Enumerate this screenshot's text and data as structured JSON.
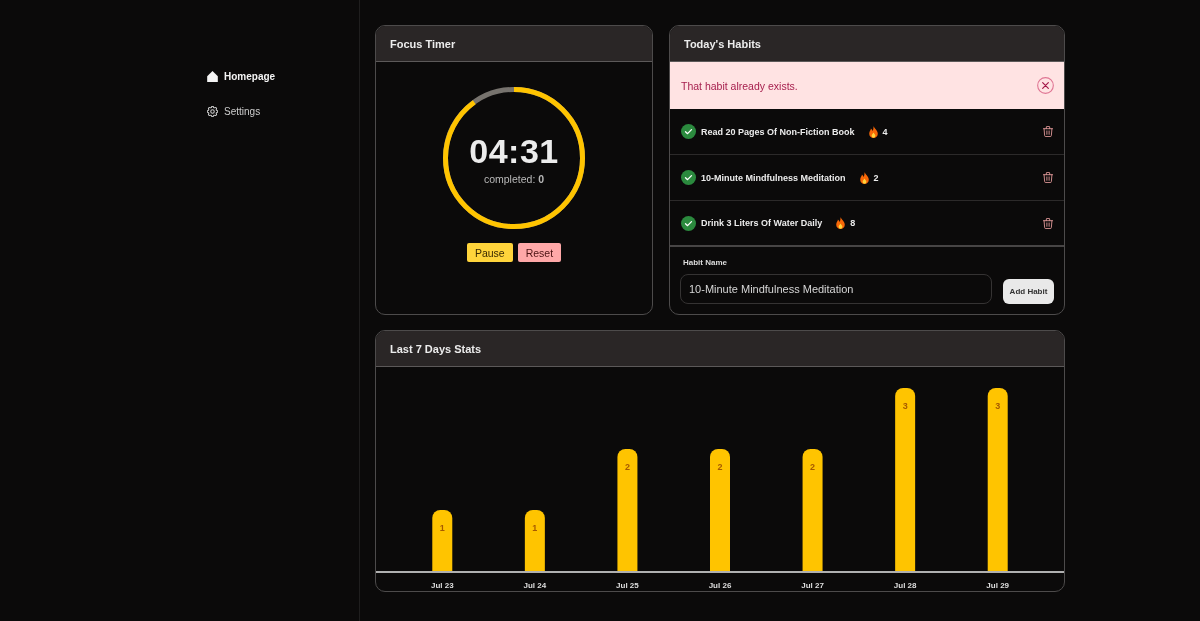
{
  "sidebar": {
    "items": [
      {
        "label": "Homepage",
        "selected": true
      },
      {
        "label": "Settings",
        "selected": false
      }
    ]
  },
  "timer": {
    "title": "Focus Timer",
    "time": "04:31",
    "completed": "completed: **0**",
    "level": 0.9,
    "buttons": [
      {
        "label": "Pause",
        "kind": "pause"
      },
      {
        "label": "Reset",
        "kind": "reset"
      }
    ]
  },
  "habits": {
    "title": "Today's Habits",
    "alert": {
      "message": "That habit already exists."
    },
    "items": [
      {
        "name": "Read 20 Pages Of Non-Fiction Book",
        "done": true,
        "streak": "4"
      },
      {
        "name": "10-Minute Mindfulness Meditation",
        "done": true,
        "streak": "2"
      },
      {
        "name": "Drink 3 Liters Of Water Daily",
        "done": true,
        "streak": "8"
      }
    ],
    "form": {
      "label": "Habit Name",
      "value": "10-Minute Mindfulness Meditation",
      "button": "Add Habit"
    }
  },
  "stats": {
    "title": "Last 7 Days Stats",
    "chart_data": {
      "type": "bar",
      "categories": [
        "Jul 23",
        "Jul 24",
        "Jul 25",
        "Jul 26",
        "Jul 27",
        "Jul 28",
        "Jul 29"
      ],
      "values": [
        1,
        1,
        2,
        2,
        2,
        3,
        3
      ],
      "data_labels": true
    }
  }
}
